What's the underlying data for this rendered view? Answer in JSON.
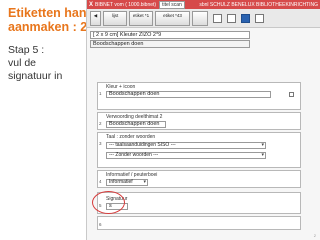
{
  "slide": {
    "title_line1": "Etiketten handmatig",
    "title_line2": "aanmaken : 2*9",
    "step_lines": [
      "Stap 5 :",
      "vul de",
      "signatuur in"
    ]
  },
  "app": {
    "topbar": {
      "close_glyph": "X",
      "program": "BIBNET vom ( 1000.bibnet)",
      "button": "titel scan",
      "brand": "sbnl SCHULZ BENELUX BIBLIOTHEEKINRICHTING"
    },
    "toolbar": {
      "buttons": [
        "lijst",
        "etiket *1",
        "etiket *43",
        ""
      ],
      "icons": [
        "list-icon",
        "tag-icon",
        "info-icon",
        "print-icon"
      ]
    },
    "rows": [
      "[ 2 x 9 cm] Kleuter ZIZO 2*9",
      "Boodschappen doen"
    ],
    "fields": [
      {
        "num": "1",
        "label": "Kleur + icoon",
        "value": "Boodschappen doen"
      },
      {
        "num": "2",
        "label": "Verwoording deelthimat 2",
        "value": "Boodschappen doen"
      },
      {
        "num": "3",
        "label": "Taal : zonder woorden",
        "select1": "--- taalsaanduidingen SISO ---",
        "select2": "--- Zonder woorden ---"
      },
      {
        "num": "4",
        "label": "Informatief / peuterboei",
        "select1": "Informatief"
      },
      {
        "num": "5",
        "label": "Signatuur",
        "value": "s"
      },
      {
        "num": "6",
        "label": ""
      }
    ]
  },
  "colors": {
    "title": "#e8761c",
    "highlight": "#d63a3a",
    "topbar": "#d64a4a"
  }
}
